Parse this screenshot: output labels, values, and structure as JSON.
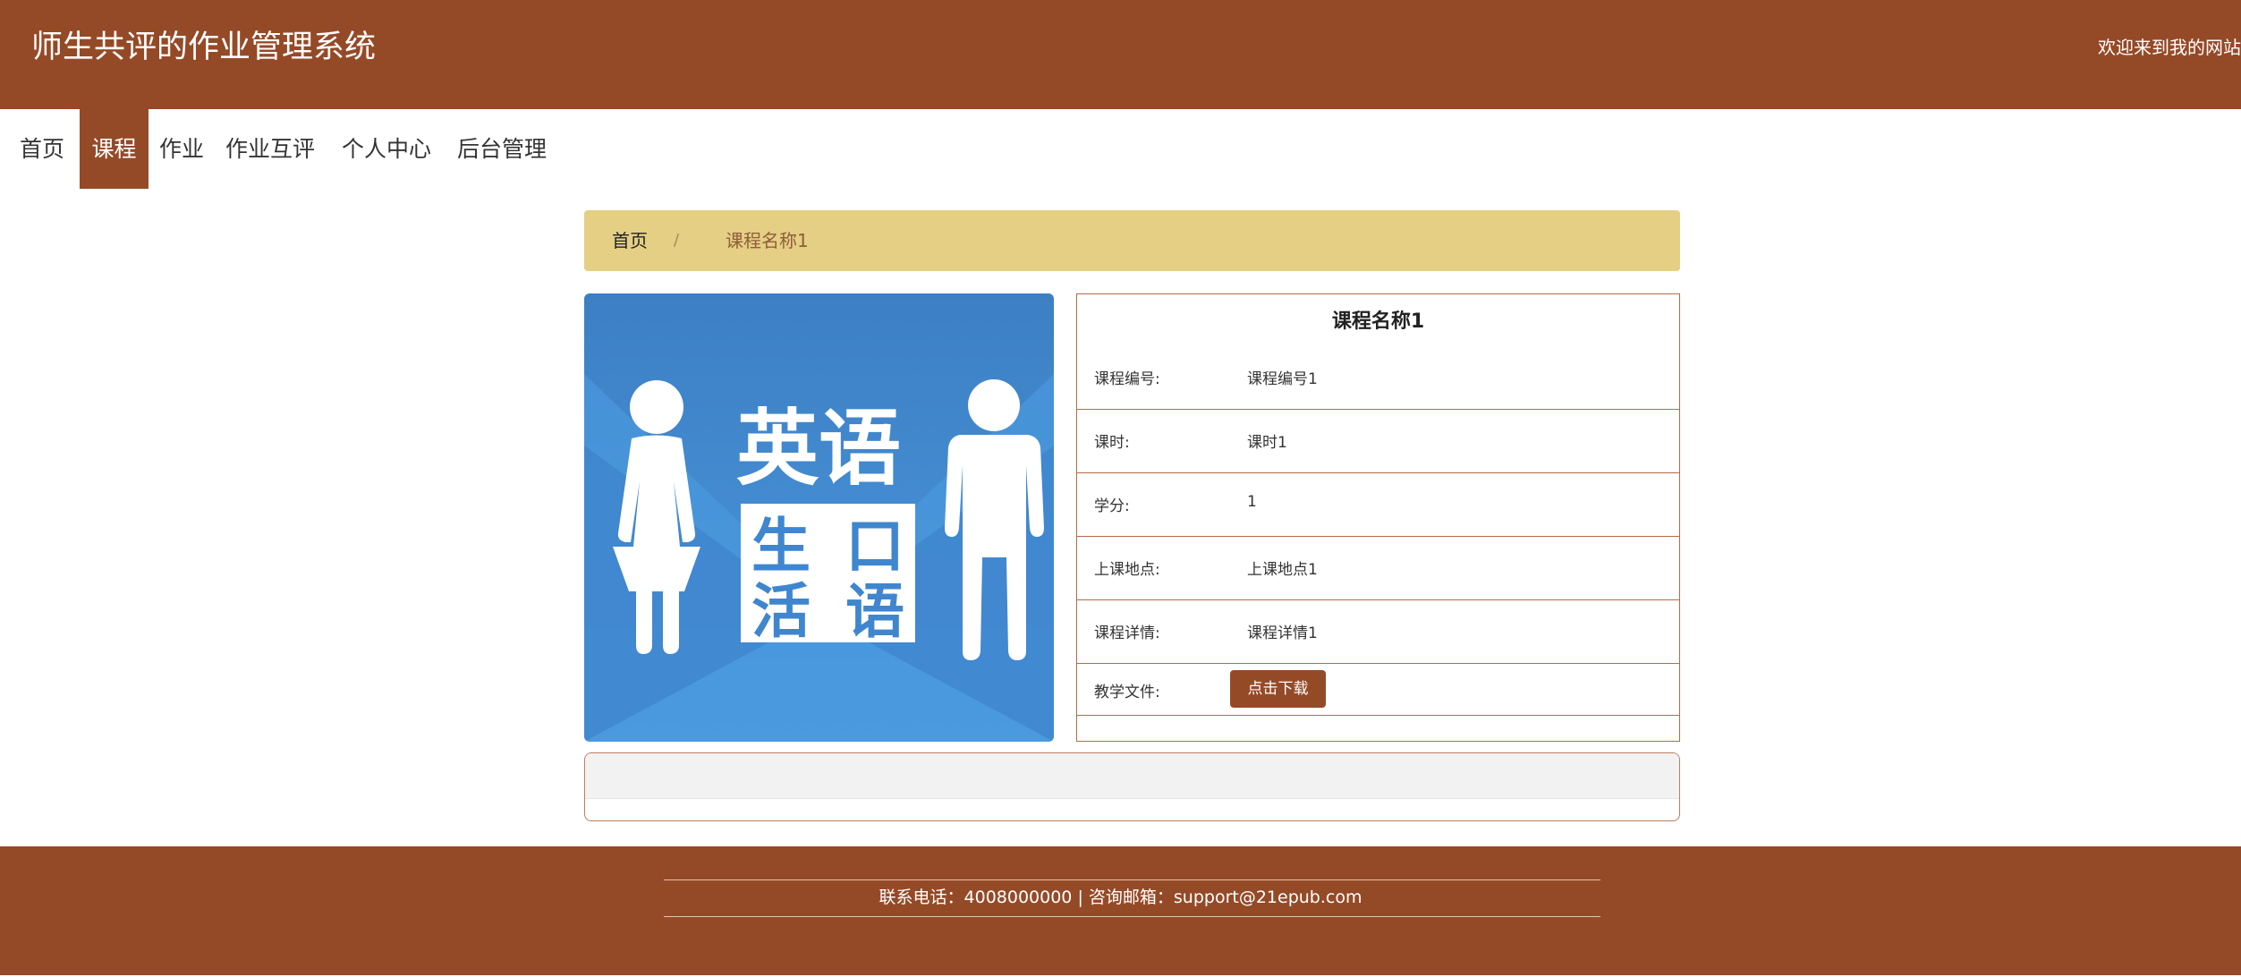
{
  "header": {
    "site_title": "师生共评的作业管理系统",
    "welcome": "欢迎来到我的网站"
  },
  "nav": {
    "items": [
      {
        "label": "首页"
      },
      {
        "label": "课程",
        "active": true
      },
      {
        "label": "作业"
      },
      {
        "label": "作业互评"
      },
      {
        "label": "个人中心"
      },
      {
        "label": "后台管理"
      }
    ]
  },
  "breadcrumb": {
    "home": "首页",
    "separator": "/",
    "current": "课程名称1"
  },
  "course_image": {
    "title_text": "英语",
    "subtitle_chars": [
      "生",
      "口",
      "活",
      "语"
    ]
  },
  "detail": {
    "title": "课程名称1",
    "rows": [
      {
        "label": "课程编号:",
        "value": "课程编号1"
      },
      {
        "label": "课时:",
        "value": "课时1"
      },
      {
        "label": "学分:",
        "value": "1"
      },
      {
        "label": "上课地点:",
        "value": "上课地点1"
      },
      {
        "label": "课程详情:",
        "value": "课程详情1"
      }
    ],
    "file_label": "教学文件:",
    "download_label": "点击下载"
  },
  "footer": {
    "text": "联系电话：4008000000 | 咨询邮箱：support@21epub.com"
  },
  "colors": {
    "brand": "#954a27",
    "breadcrumb_bg": "#e4cf84",
    "image_blue": "#3f86cf"
  }
}
